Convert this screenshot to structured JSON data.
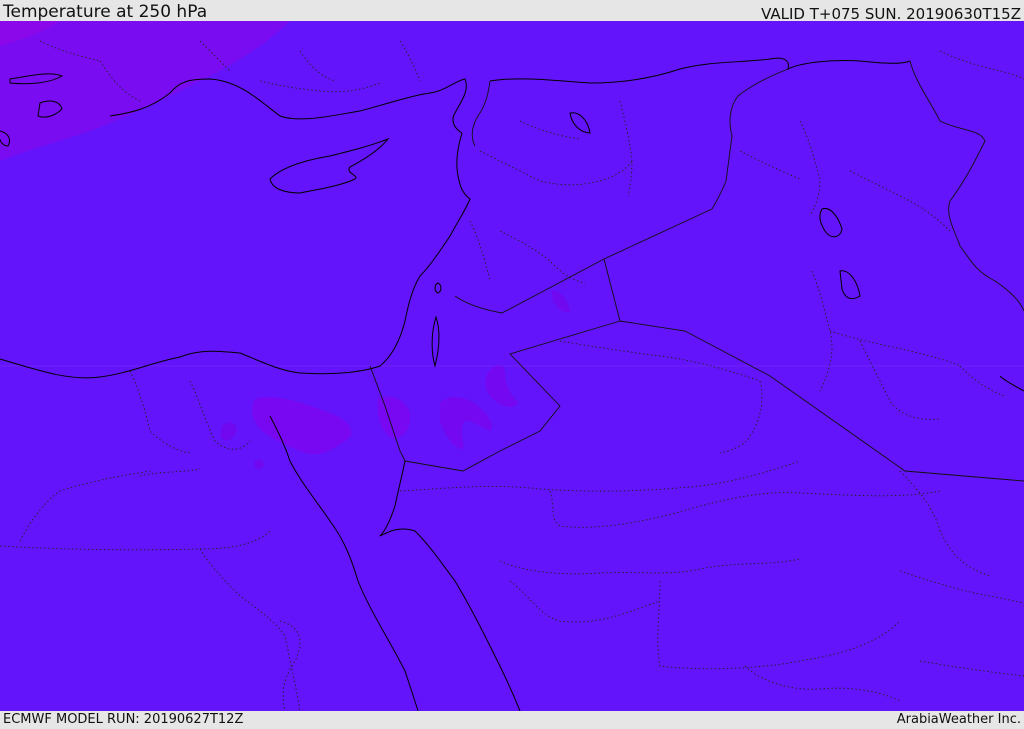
{
  "header": {
    "title": "Temperature at 250 hPa",
    "valid": "VALID T+075 SUN. 20190630T15Z"
  },
  "footer": {
    "model_run": "ECMWF MODEL RUN: 20190627T12Z",
    "provider": "ArabiaWeather Inc."
  },
  "colors": {
    "field_main": "#6414fa",
    "field_warm_nw": "#7a0cf2",
    "field_warm_patch": "#7708f0",
    "coast_line": "#000000",
    "border_line": "#222222",
    "background": "#e6e6e6"
  }
}
